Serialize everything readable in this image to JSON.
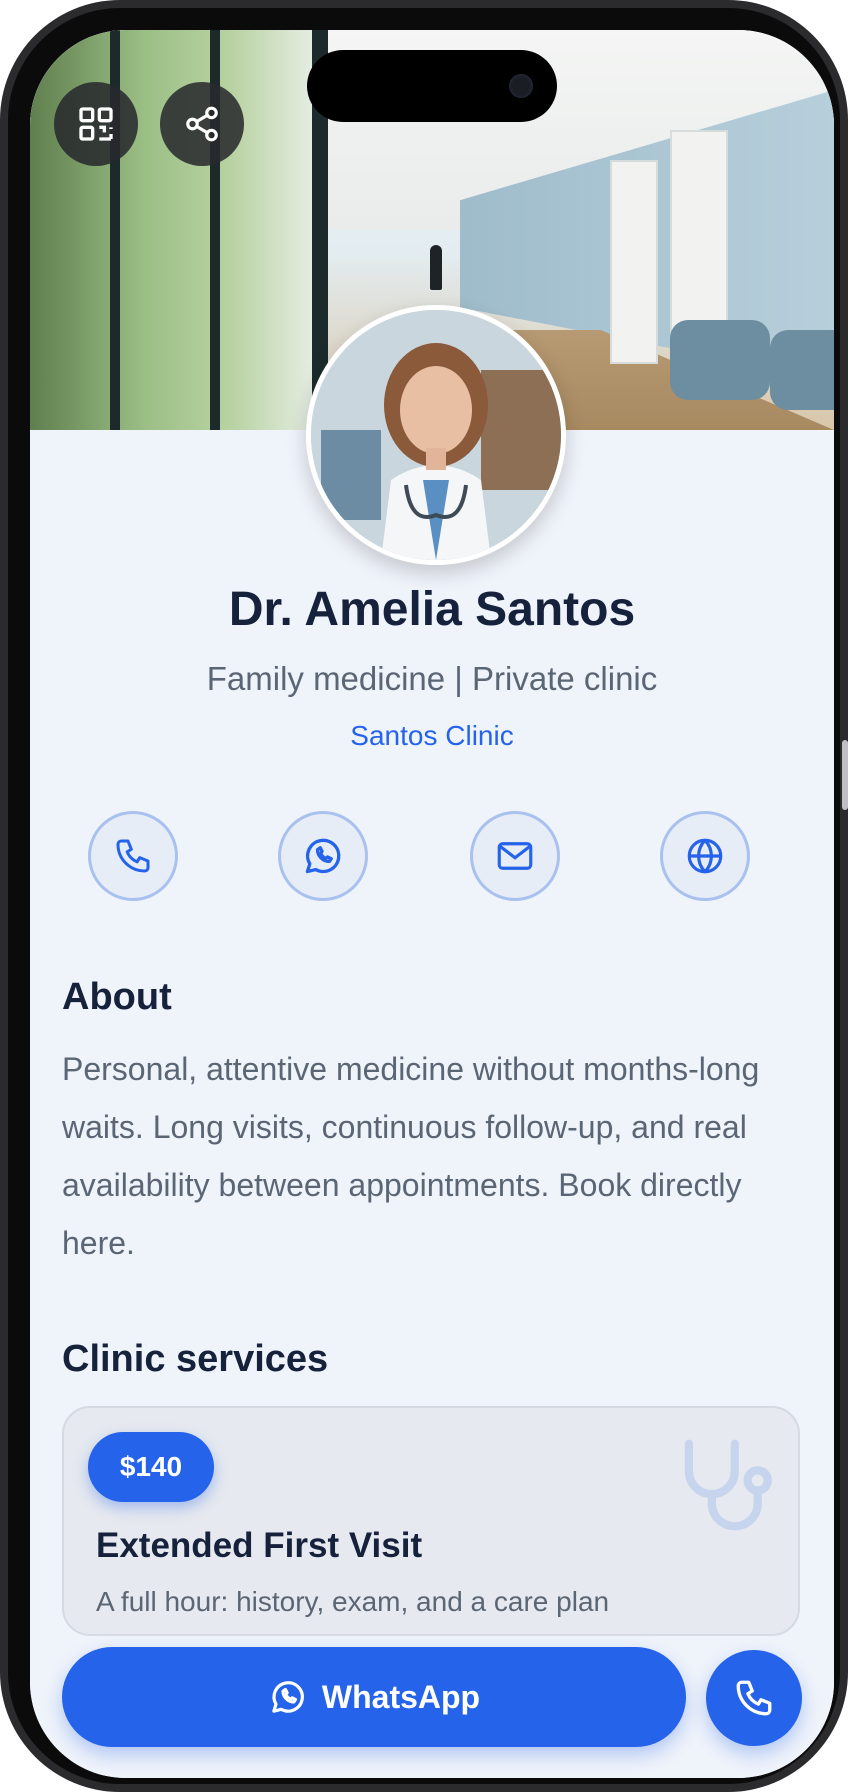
{
  "profile": {
    "name": "Dr. Amelia Santos",
    "subtitle": "Family medicine | Private clinic",
    "clinic": "Santos Clinic"
  },
  "top_actions": [
    {
      "icon": "qr-code-icon"
    },
    {
      "icon": "share-icon"
    }
  ],
  "contact_actions": [
    {
      "icon": "phone-icon"
    },
    {
      "icon": "whatsapp-icon"
    },
    {
      "icon": "mail-icon"
    },
    {
      "icon": "globe-icon"
    }
  ],
  "about": {
    "heading": "About",
    "text": "Personal, attentive medicine without months-long waits. Long visits, continuous follow-up, and real availability between appointments. Book directly here."
  },
  "services": {
    "heading": "Clinic services",
    "items": [
      {
        "price": "$140",
        "title": "Extended First Visit",
        "description": "A full hour: history, exam, and a care plan",
        "icon": "stethoscope-icon"
      }
    ]
  },
  "bottom_bar": {
    "whatsapp_label": "WhatsApp",
    "call_icon": "phone-icon"
  },
  "colors": {
    "accent": "#2563eb",
    "heading": "#16213c",
    "body_text": "#5b6675",
    "background": "#eff3fa"
  }
}
